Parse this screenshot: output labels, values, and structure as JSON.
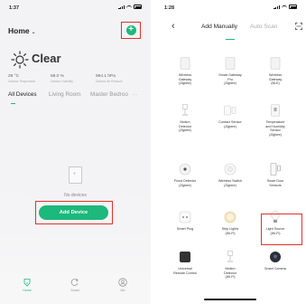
{
  "left_screen": {
    "status_time": "1:37",
    "title": "Home",
    "title_chevron": "⌄",
    "add_icon_label": "+",
    "weather": "Clear",
    "stats": [
      {
        "value": "29 °C",
        "label": "Outdoor Temperature"
      },
      {
        "value": "58.0 %",
        "label": "Outdoor Humidity"
      },
      {
        "value": "994.1 hPa",
        "label": "Outdoor Air Pressure"
      }
    ],
    "tabs": [
      "All Devices",
      "Living Room",
      "Master Bedroo"
    ],
    "more": "···",
    "empty_text": "No devices",
    "add_device_label": "Add Device",
    "nav": [
      {
        "label": "Home",
        "icon": "home-icon"
      },
      {
        "label": "Smart",
        "icon": "smart-icon"
      },
      {
        "label": "Me",
        "icon": "me-icon"
      }
    ],
    "accent": "#1cb87c",
    "highlight": "#e3312d"
  },
  "right_screen": {
    "status_time": "1:28",
    "back_icon": "‹",
    "tab_active": "Add Manually",
    "tab_inactive": "Auto Scan",
    "devices": [
      {
        "label": "Wireless\nGateway\n(Zigbee)",
        "icon": "gateway-icon"
      },
      {
        "label": "Smart Gateway\nPro\n(Zigbee)",
        "icon": "gateway-pro-icon"
      },
      {
        "label": "Wireless\nGateway\n(BLE)",
        "icon": "gateway-ble-icon"
      },
      {
        "label": "Motion\nDetector\n(Zigbee)",
        "icon": "motion-detector-icon"
      },
      {
        "label": "Contact Sensor\n(Zigbee)",
        "icon": "contact-sensor-icon"
      },
      {
        "label": "Temperature\nand Humidity\nSensor\n(Zigbee)",
        "icon": "temperature-sensor-icon"
      },
      {
        "label": "Flood Detector\n(Zigbee)",
        "icon": "flood-detector-icon"
      },
      {
        "label": "Wireless Switch\n(Zigbee)",
        "icon": "wireless-switch-icon"
      },
      {
        "label": "Smart Door\nSensors",
        "icon": "door-sensor-icon"
      },
      {
        "label": "Smart Plug",
        "icon": "smart-plug-icon"
      },
      {
        "label": "Strip Lights\n(Wi-Fi)",
        "icon": "strip-lights-icon"
      },
      {
        "label": "Light Source\n(Wi-Fi)",
        "icon": "light-source-icon"
      },
      {
        "label": "Universal\nRemote Control",
        "icon": "remote-control-icon"
      },
      {
        "label": "Motion\nDetector\n(Wi-Fi)",
        "icon": "motion-detector-wifi-icon"
      },
      {
        "label": "Smart Camera",
        "icon": "smart-camera-icon"
      }
    ]
  }
}
